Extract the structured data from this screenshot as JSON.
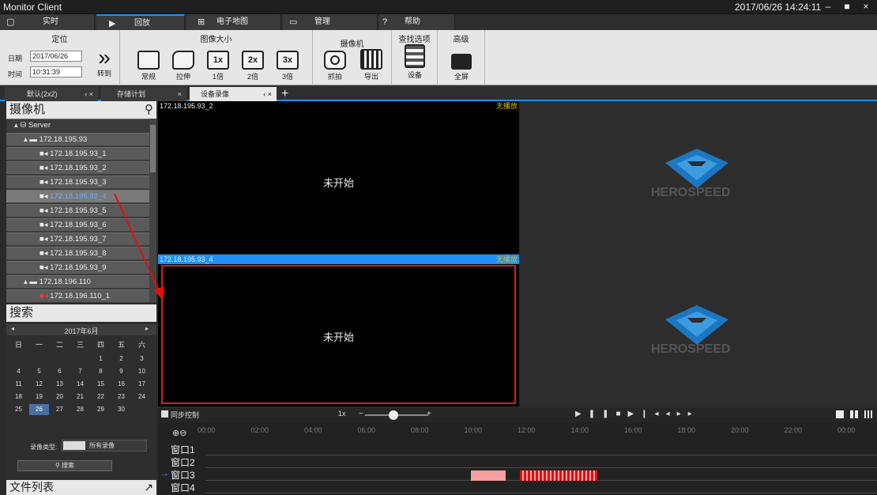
{
  "window": {
    "title": "Monitor Client",
    "datetime": "2017/06/26 14:24:11",
    "min": "–",
    "max": "■",
    "close": "×",
    "pin": "+"
  },
  "menu": [
    {
      "icon": "▢",
      "label": "实时"
    },
    {
      "icon": "▶",
      "label": "回放"
    },
    {
      "icon": "⊞",
      "label": "电子地图"
    },
    {
      "icon": "▭",
      "label": "管理"
    },
    {
      "icon": "?",
      "label": "帮助"
    }
  ],
  "ribbon": {
    "locate": {
      "title": "定位",
      "date_label": "日期",
      "date_value": "2017/06/26",
      "time_label": "时间",
      "time_value": "10:31:39",
      "goto": "转到"
    },
    "image_size": {
      "title": "图像大小",
      "buttons": [
        "常规",
        "拉伸",
        "1倍",
        "2倍",
        "3倍"
      ],
      "glyphs": [
        "",
        "",
        "1x",
        "2x",
        "3x"
      ]
    },
    "camera": {
      "title": "摄像机",
      "buttons": [
        "抓拍",
        "导出"
      ]
    },
    "search_opts": {
      "title": "查找选项",
      "button": "设备"
    },
    "advanced": {
      "title": "高级",
      "button": "全屏"
    }
  },
  "viewtabs": [
    {
      "label": "默认(2x2)",
      "extra": "‹ ×"
    },
    {
      "label": "存储计划",
      "extra": "×"
    },
    {
      "label": "设备录像",
      "extra": "‹ ×"
    }
  ],
  "viewtab_add": "+",
  "camera_panel": {
    "title": "摄像机",
    "tree": [
      {
        "label": "Server",
        "level": 0
      },
      {
        "label": "172.18.195.93",
        "level": 1
      },
      {
        "label": "172.18.195.93_1",
        "level": 2
      },
      {
        "label": "172.18.195.93_2",
        "level": 2
      },
      {
        "label": "172.18.195.93_3",
        "level": 2
      },
      {
        "label": "172.18.195.93_4",
        "level": 2
      },
      {
        "label": "172.18.195.93_5",
        "level": 2
      },
      {
        "label": "172.18.195.93_6",
        "level": 2
      },
      {
        "label": "172.18.195.93_7",
        "level": 2
      },
      {
        "label": "172.18.195.93_8",
        "level": 2
      },
      {
        "label": "172.18.195.93_9",
        "level": 2
      },
      {
        "label": "172.18.196.110",
        "level": 1
      },
      {
        "label": "172.18.196.110_1",
        "level": 2
      }
    ]
  },
  "search_panel": {
    "title": "搜索",
    "month": "2017年6月",
    "weekdays": [
      "日",
      "一",
      "二",
      "三",
      "四",
      "五",
      "六"
    ],
    "weeks": [
      [
        "",
        "",
        "",
        "",
        "1",
        "2",
        "3"
      ],
      [
        "4",
        "5",
        "6",
        "7",
        "8",
        "9",
        "10"
      ],
      [
        "11",
        "12",
        "13",
        "14",
        "15",
        "16",
        "17"
      ],
      [
        "18",
        "19",
        "20",
        "21",
        "22",
        "23",
        "24"
      ],
      [
        "25",
        "26",
        "27",
        "28",
        "29",
        "30",
        ""
      ]
    ],
    "selected_day": "26",
    "record_type_label": "录像类型:",
    "record_type_value": "所有录像",
    "search_button": "搜索",
    "file_list": "文件列表"
  },
  "panes": [
    {
      "name": "172.18.195.93_2",
      "status": "无播放",
      "text": "未开始"
    },
    {
      "name": "",
      "status": "",
      "text": "",
      "logo": "HEROSPEED"
    },
    {
      "name": "172.18.195.93_4",
      "status": "无播放",
      "text": "未开始"
    },
    {
      "name": "",
      "status": "",
      "text": "",
      "logo": "HEROSPEED"
    }
  ],
  "playback": {
    "sync": "同步控制",
    "speed": "1x",
    "minus": "−",
    "plus": "+"
  },
  "timeline": {
    "hours": [
      "00:00",
      "02:00",
      "04:00",
      "06:00",
      "08:00",
      "10:00",
      "12:00",
      "14:00",
      "16:00",
      "18:00",
      "20:00",
      "22:00",
      "00:00"
    ],
    "windows": [
      "窗口1",
      "窗口2",
      "窗口3",
      "窗口4"
    ],
    "active_window": "窗口3"
  }
}
